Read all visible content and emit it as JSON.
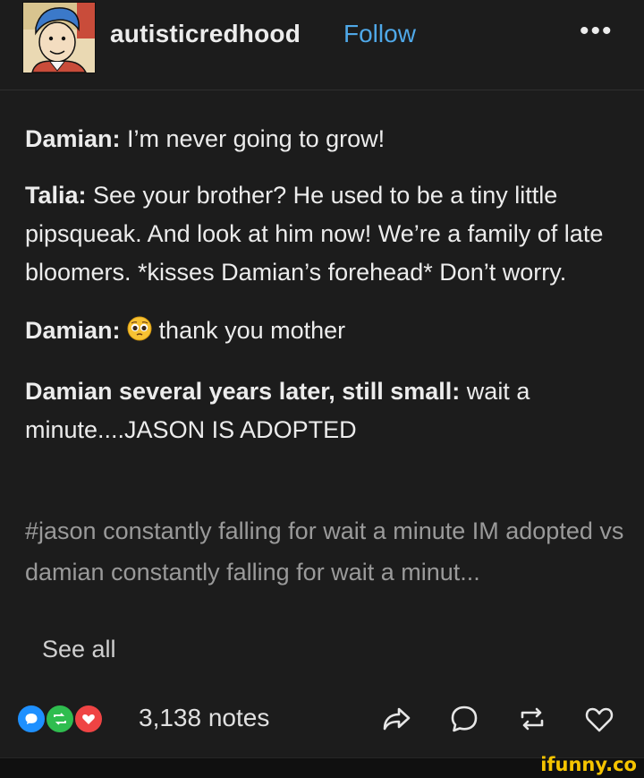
{
  "header": {
    "username": "autisticredhood",
    "follow_label": "Follow",
    "more_label": "•••",
    "avatar_alt": "comic-boy-avatar"
  },
  "post": {
    "paragraphs": [
      {
        "speaker": "Damian:",
        "text": " I’m never going to grow!"
      },
      {
        "speaker": "Talia:",
        "text": " See your brother? He used to be a tiny little pipsqueak. And look at him now! We’re a family of late bloomers. *kisses Damian’s forehead* Don’t worry."
      },
      {
        "speaker": "Damian:",
        "emoji": "pleading-face-emoji",
        "text": " thank you mother"
      },
      {
        "speaker": "Damian several years later, still small:",
        "text": " wait a minute....JASON IS ADOPTED"
      }
    ],
    "tags": "#jason constantly falling for wait a minute IM adopted vs damian constantly falling for wait a minut...",
    "see_all": "See all"
  },
  "footer": {
    "notes": "3,138 notes",
    "note_icons": [
      "reply-bubble-icon",
      "reblog-bubble-icon",
      "like-bubble-icon"
    ],
    "colors": {
      "reply": "#1e90ff",
      "reblog": "#2fbd4f",
      "like": "#ef4444"
    },
    "actions": [
      "share-icon",
      "comment-icon",
      "reblog-icon",
      "heart-icon"
    ]
  },
  "watermark": "ifunny.co"
}
